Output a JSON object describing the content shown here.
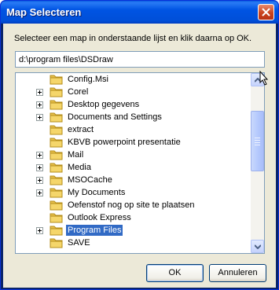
{
  "window": {
    "title": "Map Selecteren"
  },
  "dialog": {
    "prompt": "Selecteer een map in onderstaande lijst en klik daarna op OK.",
    "path_value": "d:\\program files\\DSDraw"
  },
  "tree": {
    "items": [
      {
        "label": "Config.Msi",
        "expandable": false,
        "selected": false
      },
      {
        "label": "Corel",
        "expandable": true,
        "selected": false
      },
      {
        "label": "Desktop gegevens",
        "expandable": true,
        "selected": false
      },
      {
        "label": "Documents and Settings",
        "expandable": true,
        "selected": false
      },
      {
        "label": "extract",
        "expandable": false,
        "selected": false
      },
      {
        "label": "KBVB powerpoint presentatie",
        "expandable": false,
        "selected": false
      },
      {
        "label": "Mail",
        "expandable": true,
        "selected": false
      },
      {
        "label": "Media",
        "expandable": true,
        "selected": false
      },
      {
        "label": "MSOCache",
        "expandable": true,
        "selected": false
      },
      {
        "label": "My Documents",
        "expandable": true,
        "selected": false
      },
      {
        "label": "Oefenstof nog op site te plaatsen",
        "expandable": false,
        "selected": false
      },
      {
        "label": "Outlook Express",
        "expandable": false,
        "selected": false
      },
      {
        "label": "Program Files",
        "expandable": true,
        "selected": true
      },
      {
        "label": "SAVE",
        "expandable": false,
        "selected": false
      }
    ]
  },
  "buttons": {
    "ok": "OK",
    "cancel": "Annuleren"
  },
  "colors": {
    "selection": "#316ac5",
    "titlebar": "#0054e3",
    "folder": "#f5d66a"
  }
}
